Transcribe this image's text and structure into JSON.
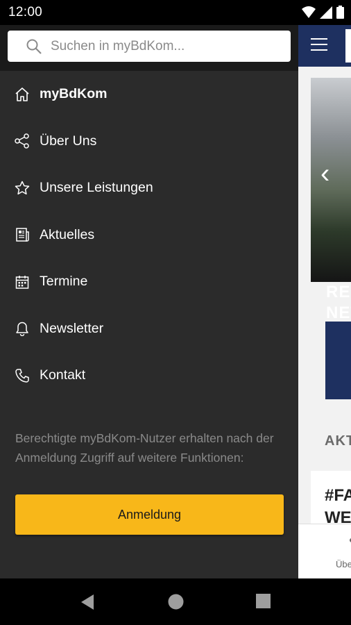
{
  "status_bar": {
    "time": "12:00"
  },
  "search": {
    "placeholder": "Suchen in myBdKom..."
  },
  "menu": {
    "items": [
      {
        "label": "myBdKom",
        "icon": "home-icon"
      },
      {
        "label": "Über Uns",
        "icon": "share-icon"
      },
      {
        "label": "Unsere Leistungen",
        "icon": "star-icon"
      },
      {
        "label": "Aktuelles",
        "icon": "newspaper-icon"
      },
      {
        "label": "Termine",
        "icon": "calendar-icon"
      },
      {
        "label": "Newsletter",
        "icon": "bell-icon"
      },
      {
        "label": "Kontakt",
        "icon": "phone-icon"
      }
    ]
  },
  "info_text": "Berechtigte myBdKom-Nutzer erhalten nach der Anmeldung Zugriff auf weitere Funktionen:",
  "login_label": "Anmeldung",
  "background_app": {
    "hero_text_1": "REG",
    "hero_text_2": "NET",
    "section_label": "AKT",
    "card_title_1": "#FA",
    "card_title_2": "WE",
    "bottom_nav_label": "Übe"
  },
  "colors": {
    "brand_navy": "#1e3060",
    "accent_yellow": "#f8b719",
    "drawer_bg": "#2b2b2b"
  }
}
